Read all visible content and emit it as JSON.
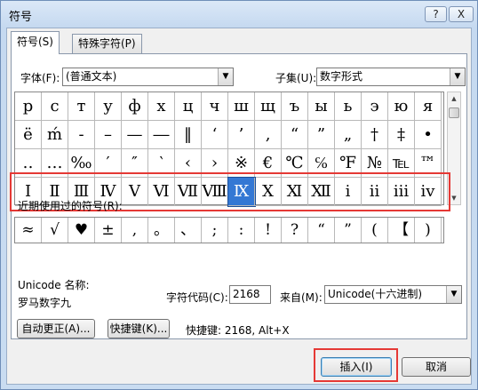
{
  "window": {
    "title": "符号",
    "help_label": "?",
    "close_label": "X"
  },
  "tabs": [
    {
      "label": "符号(S)",
      "active": true
    },
    {
      "label": "特殊字符(P)",
      "active": false
    }
  ],
  "font": {
    "label": "字体(F):",
    "value": "(普通文本)"
  },
  "subset": {
    "label": "子集(U):",
    "value": "数字形式"
  },
  "symbol_grid": {
    "rows": [
      [
        "р",
        "с",
        "т",
        "у",
        "ф",
        "х",
        "ц",
        "ч",
        "ш",
        "щ",
        "ъ",
        "ы",
        "ь",
        "э",
        "ю",
        "я"
      ],
      [
        "ё",
        "ḿ",
        "-",
        "–",
        "—",
        "―",
        "‖",
        "‘",
        "’",
        "‚",
        "“",
        "”",
        "„",
        "†",
        "‡",
        "•"
      ],
      [
        "‥",
        "…",
        "‰",
        "′",
        "″",
        "‵",
        "‹",
        "›",
        "※",
        "€",
        "℃",
        "℅",
        "℉",
        "№",
        "℡",
        "™"
      ],
      [
        "Ⅰ",
        "Ⅱ",
        "Ⅲ",
        "Ⅳ",
        "Ⅴ",
        "Ⅵ",
        "Ⅶ",
        "Ⅷ",
        "Ⅸ",
        "Ⅹ",
        "Ⅺ",
        "Ⅻ",
        "ⅰ",
        "ⅱ",
        "ⅲ",
        "ⅳ"
      ]
    ],
    "selected_row": 3,
    "selected_col": 8
  },
  "recent": {
    "label": "近期使用过的符号(R):",
    "symbols": [
      "≈",
      "√",
      "♥",
      "±",
      ",",
      "。",
      "、",
      ";",
      ":",
      "!",
      "?",
      "“",
      "”",
      "(",
      "【",
      ")"
    ]
  },
  "unicode_name": {
    "label": "Unicode 名称:",
    "value": "罗马数字九"
  },
  "char_code": {
    "label": "字符代码(C):",
    "value": "2168"
  },
  "from": {
    "label": "来自(M):",
    "value": "Unicode(十六进制)"
  },
  "buttons": {
    "autocorrect": "自动更正(A)...",
    "shortcut": "快捷键(K)...",
    "shortcut_info": "快捷键: 2168, Alt+X",
    "insert": "插入(I)",
    "cancel": "取消"
  },
  "colors": {
    "highlight_box": "#e53935",
    "selection": "#3478d4"
  },
  "icons": {
    "dropdown": "▼",
    "scroll_up": "▲",
    "scroll_down": "▼"
  }
}
